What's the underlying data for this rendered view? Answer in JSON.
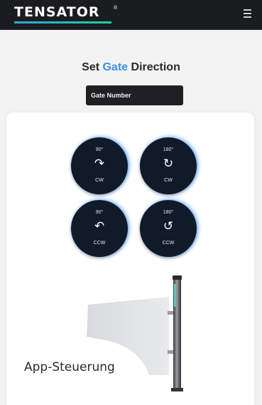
{
  "header": {
    "logo_text": "TENSATOR",
    "logo_mark": "®",
    "menu_icon": "hamburger-menu-icon"
  },
  "title": {
    "prefix": "Set ",
    "accent": "Gate",
    "suffix": " Direction",
    "accent_color": "#3f8fe6"
  },
  "gate_field": {
    "placeholder": "Gate Number"
  },
  "buttons": [
    {
      "degrees": "90°",
      "arrow": "↷",
      "direction": "CW",
      "icon": "rotate-cw-90-icon"
    },
    {
      "degrees": "180°",
      "arrow": "↻",
      "direction": "CW",
      "icon": "rotate-cw-180-icon"
    },
    {
      "degrees": "90°",
      "arrow": "↶",
      "direction": "CCW",
      "icon": "rotate-ccw-90-icon"
    },
    {
      "degrees": "180°",
      "arrow": "↺",
      "direction": "CCW",
      "icon": "rotate-ccw-180-icon"
    }
  ],
  "caption": "App-Steuerung"
}
